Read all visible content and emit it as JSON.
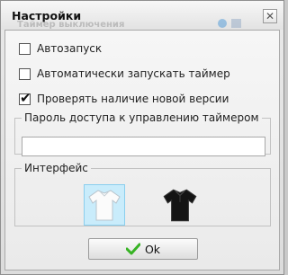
{
  "window": {
    "title": "Настройки",
    "background_title": "Таймер выключения"
  },
  "options": [
    {
      "label": "Автозапуск",
      "checked": false
    },
    {
      "label": "Автоматически запускать таймер",
      "checked": false
    },
    {
      "label": "Проверять наличие новой версии",
      "checked": true
    }
  ],
  "password": {
    "legend": "Пароль доступа к управлению таймером",
    "value": ""
  },
  "interface": {
    "legend": "Интерфейс",
    "themes": [
      {
        "name": "white-shirt-icon",
        "selected": true
      },
      {
        "name": "black-shirt-icon",
        "selected": false
      }
    ]
  },
  "ok_button": {
    "label": "Ok",
    "icon": "green-checkmark-icon"
  },
  "colors": {
    "selected_theme_bg": "#c9ecfb",
    "check_green": "#37b324"
  }
}
